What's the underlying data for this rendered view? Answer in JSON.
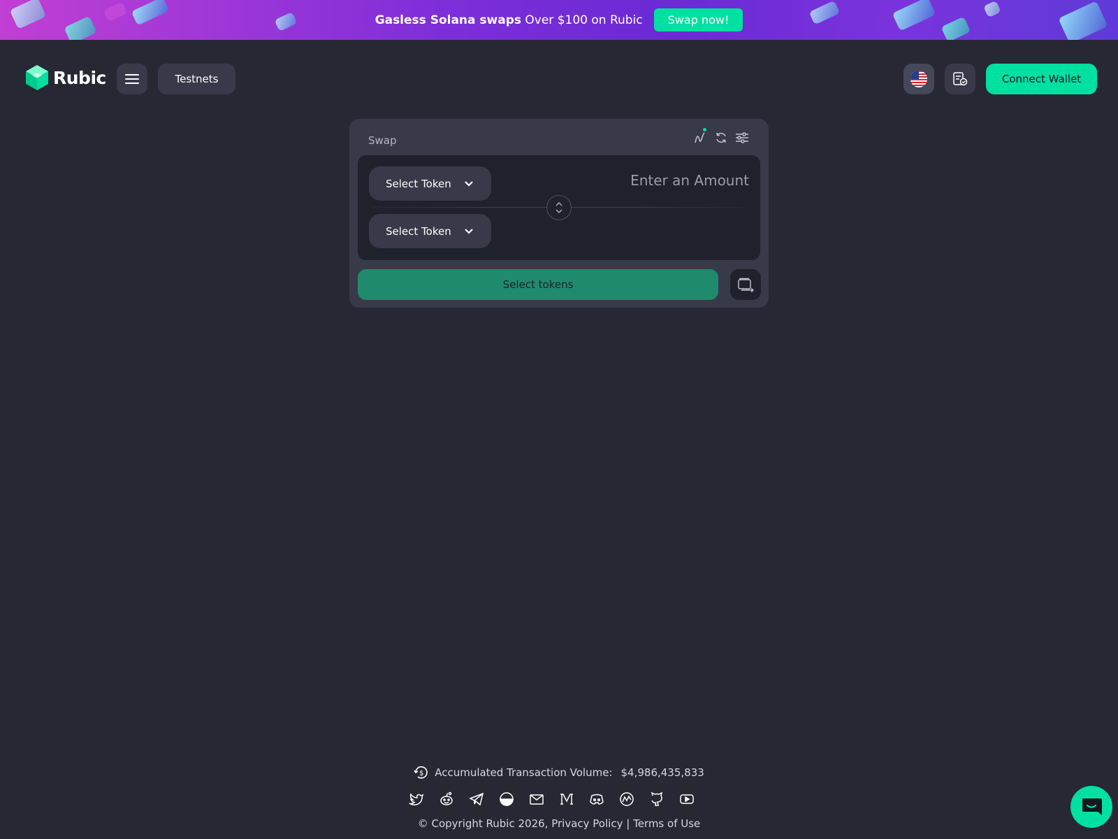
{
  "banner": {
    "headline_bold": "Gasless Solana swaps",
    "headline_rest": "Over $100 on Rubic",
    "cta_label": "Swap now!"
  },
  "header": {
    "logo_text": "Rubic",
    "testnets_label": "Testnets",
    "connect_wallet_label": "Connect Wallet",
    "language_icon": "us-flag-icon",
    "history_icon": "receipt-check-icon",
    "menu_icon": "hamburger-menu-icon"
  },
  "swap": {
    "title": "Swap",
    "tools": [
      "chart-icon",
      "refresh-icon",
      "settings-sliders-icon"
    ],
    "from_token_label": "Select Token",
    "to_token_label": "Select Token",
    "amount_placeholder": "Enter an Amount",
    "action_label": "Select tokens"
  },
  "footer": {
    "volume_label": "Accumulated Transaction Volume:",
    "volume_value": "$4,986,435,833",
    "socials": [
      "twitter-icon",
      "reddit-icon",
      "telegram-icon",
      "coinmarketcap-icon",
      "email-icon",
      "medium-icon",
      "discord-icon",
      "coingecko-icon",
      "github-icon",
      "youtube-icon"
    ],
    "copyright": "© Copyright Rubic 2026,",
    "privacy_label": "Privacy Policy",
    "separator": "|",
    "terms_label": "Terms of Use"
  },
  "colors": {
    "background": "#272833",
    "accent": "#00e0a1",
    "card": "#383a4a",
    "inner": "#20212c"
  }
}
